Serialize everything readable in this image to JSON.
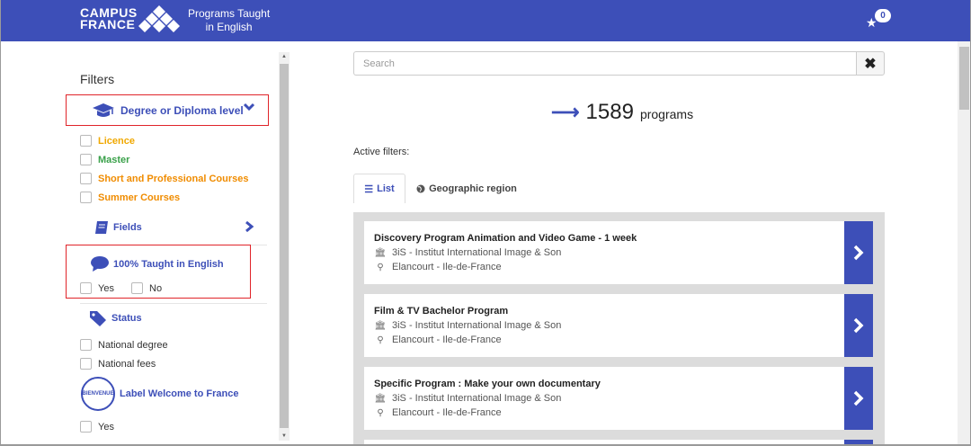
{
  "header": {
    "logo_line1": "CAMPUS",
    "logo_line2": "FRANCE",
    "tagline_line1": "Programs Taught",
    "tagline_line2": "in English",
    "favorites_count": "0",
    "bar_color": "#3d4fb8"
  },
  "sidebar": {
    "title": "Filters",
    "degree": {
      "label": "Degree or Diploma level",
      "options": [
        {
          "label": "Licence",
          "color": "#f0a800"
        },
        {
          "label": "Master",
          "color": "#3aa14a"
        },
        {
          "label": "Short and Professional Courses",
          "color": "#f08c00"
        },
        {
          "label": "Summer Courses",
          "color": "#f08c00"
        }
      ]
    },
    "fields": {
      "label": "Fields"
    },
    "taught": {
      "label": "100% Taught in English",
      "yes": "Yes",
      "no": "No"
    },
    "status": {
      "label": "Status",
      "options": [
        "National degree",
        "National fees"
      ]
    },
    "welcome": {
      "label": "Label Welcome to France",
      "badge_text": "BIENVENUE",
      "yes": "Yes"
    }
  },
  "main": {
    "search_placeholder": "Search",
    "clear_symbol": "✖",
    "count": "1589",
    "count_label": "programs",
    "active_filters_label": "Active filters:",
    "tabs": [
      {
        "label": "List",
        "icon": "list-icon"
      },
      {
        "label": "Geographic region",
        "icon": "globe-icon"
      }
    ],
    "programs": [
      {
        "title": "Discovery Program Animation and Video Game - 1 week",
        "school": "3iS - Institut International Image & Son",
        "location": "Elancourt - Ile-de-France"
      },
      {
        "title": "Film & TV Bachelor Program",
        "school": "3iS - Institut International Image & Son",
        "location": "Elancourt - Ile-de-France"
      },
      {
        "title": "Specific Program : Make your own documentary",
        "school": "3iS - Institut International Image & Son",
        "location": "Elancourt - Ile-de-France"
      }
    ]
  }
}
